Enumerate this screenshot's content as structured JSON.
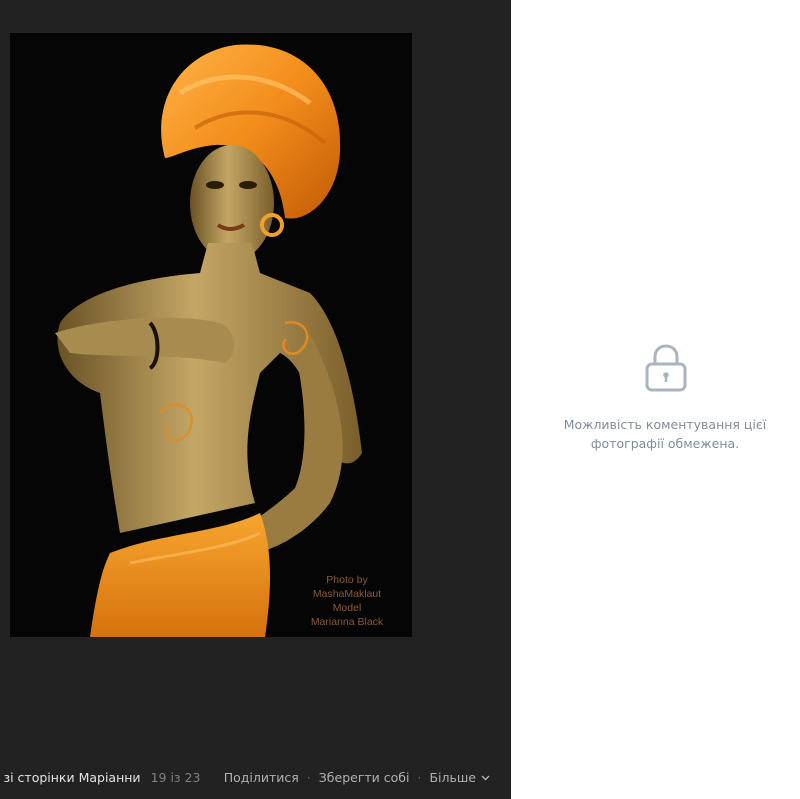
{
  "photo": {
    "credit_lines": [
      "Photo by",
      "MashaMaklaut",
      "Model",
      "Marianna Black"
    ]
  },
  "bottom_bar": {
    "album_link": "ї зі сторінки Маріанни",
    "counter": "19 із 23",
    "actions": {
      "share": "Поділитися",
      "save": "Зберегти собі",
      "more": "Більше"
    },
    "separator": "·"
  },
  "comments": {
    "notice_line1": "Можливість коментування цієї",
    "notice_line2": "фотографії обмежена."
  },
  "icons": {
    "lock": "lock-icon",
    "more": "chevron-down-icon"
  },
  "colors": {
    "viewer_background": "#222222",
    "photo_background": "#050505",
    "accent_orange": "#f28c1a",
    "comments_background": "#ffffff",
    "notice_text": "#818c99",
    "lock_icon": "#aab4c0"
  }
}
